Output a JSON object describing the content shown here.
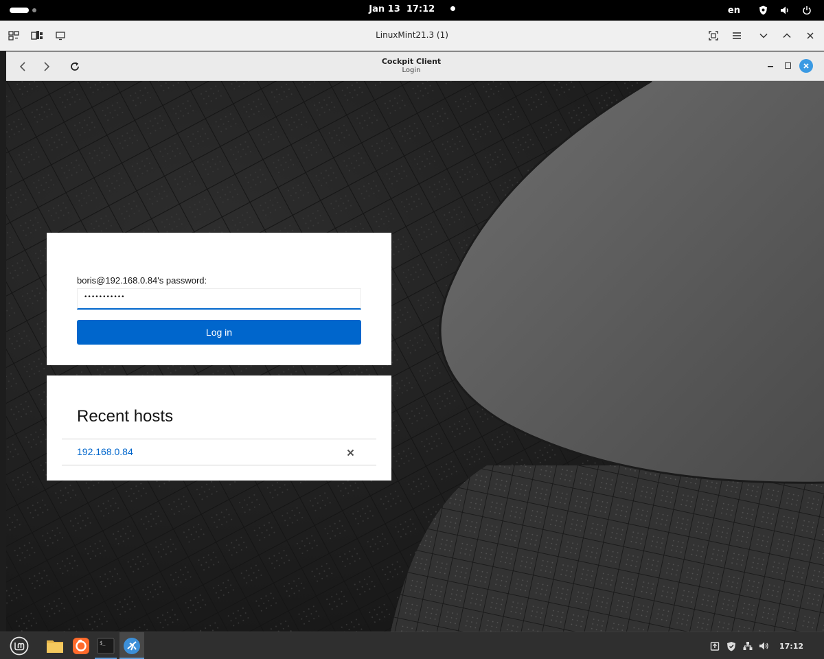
{
  "topbar": {
    "date": "Jan 13",
    "time": "17:12",
    "language": "en",
    "icons": [
      "shield-icon",
      "volume-icon",
      "power-icon"
    ]
  },
  "viewer": {
    "title": "LinuxMint21.3 (1)",
    "left_icons": [
      "display-layout-icon",
      "send-keys-icon",
      "screen-icon"
    ],
    "right_icons": [
      "fullscreen-icon",
      "menu-icon",
      "chevron-down-icon",
      "chevron-up-icon",
      "close-icon"
    ]
  },
  "cockpit_window": {
    "title": "Cockpit Client",
    "subtitle": "Login"
  },
  "login": {
    "password_label": "boris@192.168.0.84's password:",
    "password_value": "•••••••••••",
    "login_button": "Log in"
  },
  "recent_hosts": {
    "title": "Recent hosts",
    "hosts": [
      {
        "address": "192.168.0.84"
      }
    ]
  },
  "panel": {
    "launchers": [
      "mint-menu-icon",
      "files-icon",
      "firefox-icon",
      "terminal-icon",
      "cockpit-icon"
    ],
    "tray_icons": [
      "update-icon",
      "shield-icon",
      "network-icon",
      "volume-icon"
    ],
    "clock": "17:12"
  },
  "colors": {
    "accent": "#0066cc",
    "panel": "#2f2f2f",
    "mint_green": "#86be43"
  }
}
